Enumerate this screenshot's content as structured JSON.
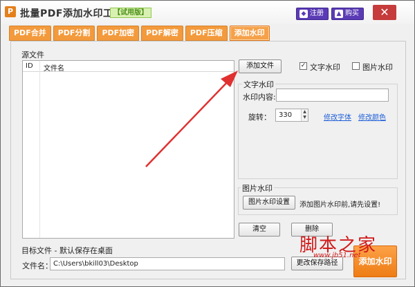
{
  "titlebar": {
    "app_icon_letter": "P",
    "title": "批量PDF添加水印工具",
    "trial_badge": "【试用版】",
    "register_label": "注册",
    "buy_label": "购买",
    "close_symbol": "✕"
  },
  "tabs": [
    {
      "label": "PDF合并"
    },
    {
      "label": "PDF分割"
    },
    {
      "label": "PDF加密"
    },
    {
      "label": "PDF解密"
    },
    {
      "label": "PDF压缩"
    },
    {
      "label": "添加水印",
      "active": true
    }
  ],
  "source": {
    "group_label": "源文件",
    "columns": {
      "id": "ID",
      "name": "文件名"
    },
    "add_file_button": "添加文件",
    "clear_button": "清空",
    "delete_button": "删除"
  },
  "options": {
    "text_watermark_label": "文字水印",
    "text_watermark_checked": true,
    "image_watermark_label": "图片水印",
    "image_watermark_checked": false
  },
  "text_watermark": {
    "group_label": "文字水印",
    "content_label": "水印内容:",
    "content_value": "",
    "rotate_label": "旋转：",
    "rotate_value": "330",
    "change_font_link": "修改字体",
    "change_color_link": "修改颜色"
  },
  "image_watermark": {
    "group_label": "图片水印",
    "settings_button": "图片水印设置",
    "hint": "添加图片水印前,请先设置!"
  },
  "target": {
    "group_label": "目标文件 - 默认保存在桌面",
    "filename_label": "文件名：",
    "path_value": "C:\\Users\\bkill03\\Desktop",
    "change_path_button": "更改保存路径",
    "start_button": "添加水印"
  },
  "watermark_overlay": {
    "text": "脚本之家",
    "sub": "www.jb51.net"
  },
  "colors": {
    "tab_orange": "#f39a3c",
    "title_button_purple": "#5b3bb5",
    "close_red": "#c63b3b",
    "arrow_red": "#e03030"
  }
}
